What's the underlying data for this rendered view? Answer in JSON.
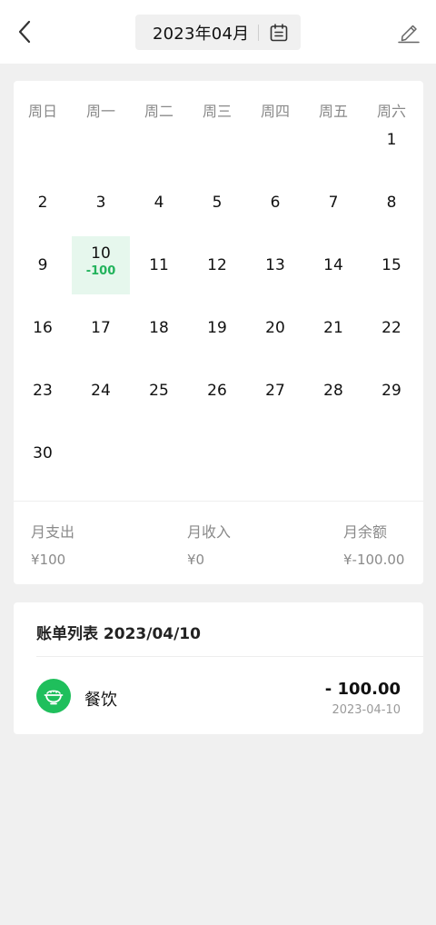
{
  "header": {
    "month_label": "2023年04月",
    "icons": {
      "back": "chevron-left-icon",
      "calendar": "calendar-icon",
      "edit": "pencil-icon"
    }
  },
  "calendar": {
    "weekdays": [
      "周日",
      "周一",
      "周二",
      "周三",
      "周四",
      "周五",
      "周六"
    ],
    "first_weekday_index": 6,
    "days_in_month": 30,
    "selected_day": 10,
    "day_amounts": {
      "10": "-100"
    }
  },
  "summary": {
    "expense_label": "月支出",
    "expense_value": "¥100",
    "income_label": "月收入",
    "income_value": "¥0",
    "balance_label": "月余额",
    "balance_value": "¥-100.00"
  },
  "bills": {
    "title": "账单列表 2023/04/10",
    "items": [
      {
        "category": "餐饮",
        "amount": "- 100.00",
        "date": "2023-04-10",
        "icon": "rice-bowl-icon"
      }
    ]
  },
  "colors": {
    "accent": "#1fbf5c",
    "selected_bg": "#e6f7ed",
    "amount_green": "#22b35c",
    "page_bg": "#f0f0f0"
  }
}
